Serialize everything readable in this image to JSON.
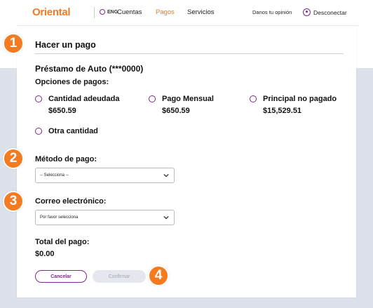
{
  "brand": {
    "logo": "Oriental",
    "accent": "#f47b20",
    "purple": "#7a2a8c"
  },
  "nav": {
    "lang": "ENG",
    "links": [
      "Cuentas",
      "Pagos",
      "Servicios"
    ],
    "active": "Pagos",
    "feedback": "Danos tu opinión",
    "logout": "Desconectar"
  },
  "page": {
    "title": "Hacer un pago",
    "loan": "Préstamo de Auto (***0000)",
    "options_label": "Opciones de pagos:",
    "options": [
      {
        "label": "Cantidad adeudada",
        "amount": "$650.59"
      },
      {
        "label": "Pago Mensual",
        "amount": "$650.59"
      },
      {
        "label": "Principal no pagado",
        "amount": "$15,529.51"
      },
      {
        "label": "Otra cantidad",
        "amount": ""
      }
    ],
    "method_label": "Método de pago:",
    "method_value": "-- Selecciona --",
    "email_label": "Correo electrónico:",
    "email_value": "Por favor selecciona",
    "total_label": "Total del pago:",
    "total_value": "$0.00",
    "cancel": "Cancelar",
    "confirm": "Confirmar"
  },
  "steps": [
    "1",
    "2",
    "3",
    "4"
  ]
}
